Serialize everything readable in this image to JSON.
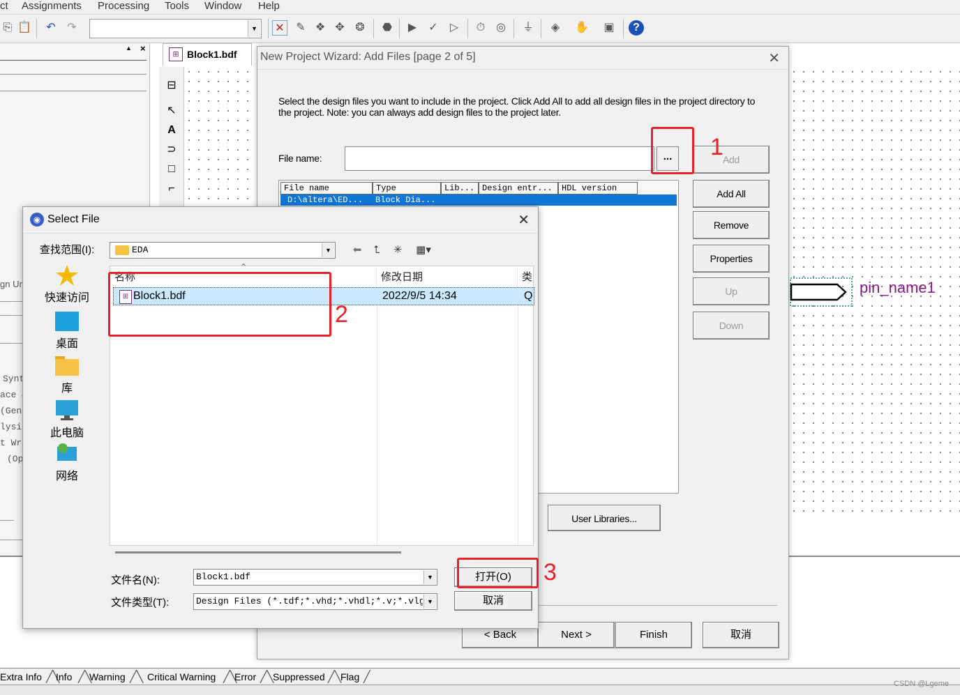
{
  "menu": [
    "ct",
    "Assignments",
    "Processing",
    "Tools",
    "Window",
    "Help"
  ],
  "schematic": {
    "tab_label": "Block1.bdf",
    "pin_label": "pin_name1"
  },
  "left_panel": {
    "partial_rows": [
      "gn Un",
      "Synt",
      "ace &",
      "(Gene",
      "lysis",
      "t Wri",
      "(Op"
    ]
  },
  "wizard": {
    "title": "New Project Wizard: Add Files [page 2 of 5]",
    "instructions": "Select the design files you want to include in the project. Click Add All to add all design files in the project directory to the project. Note: you can always add design files to the project later.",
    "file_name_label": "File name:",
    "file_name_value": "",
    "browse_label": "...",
    "buttons": {
      "add": "Add",
      "add_all": "Add All",
      "remove": "Remove",
      "properties": "Properties",
      "up": "Up",
      "down": "Down",
      "user_libraries": "User Libraries..."
    },
    "table": {
      "headers": [
        "File name",
        "Type",
        "Lib...",
        "Design entr...",
        "HDL version"
      ],
      "rows": [
        [
          "D:\\altera\\ED...",
          "Block Dia...",
          "",
          "",
          ""
        ]
      ]
    },
    "nav": {
      "back": "< Back",
      "next": "Next >",
      "finish": "Finish",
      "cancel": "取消"
    }
  },
  "select_file": {
    "title": "Select File",
    "look_in_label": "查找范围(I):",
    "look_in_value": "EDA",
    "places": [
      "快速访问",
      "桌面",
      "库",
      "此电脑",
      "网络"
    ],
    "columns": [
      "名称",
      "修改日期",
      "类"
    ],
    "files": [
      {
        "name": "Block1.bdf",
        "date": "2022/9/5 14:34",
        "type": "Q"
      }
    ],
    "file_name_label": "文件名(N):",
    "file_name_value": "Block1.bdf",
    "file_type_label": "文件类型(T):",
    "file_type_value": "Design Files (*.tdf;*.vhd;*.vhdl;*.v;*.vlg;",
    "open_button": "打开(O)",
    "cancel_button": "取消"
  },
  "annotations": [
    "1",
    "2",
    "3"
  ],
  "message_tabs": [
    "Extra Info",
    "Info",
    "Warning",
    "Critical Warning",
    "Error",
    "Suppressed",
    "Flag"
  ],
  "watermark": "CSDN @Lgeme",
  "colors": {
    "annotation_red": "#e8222a",
    "selection_blue": "#1077d7",
    "pin_purple": "#8a1a8a",
    "selected_row": "#cce8ff"
  }
}
